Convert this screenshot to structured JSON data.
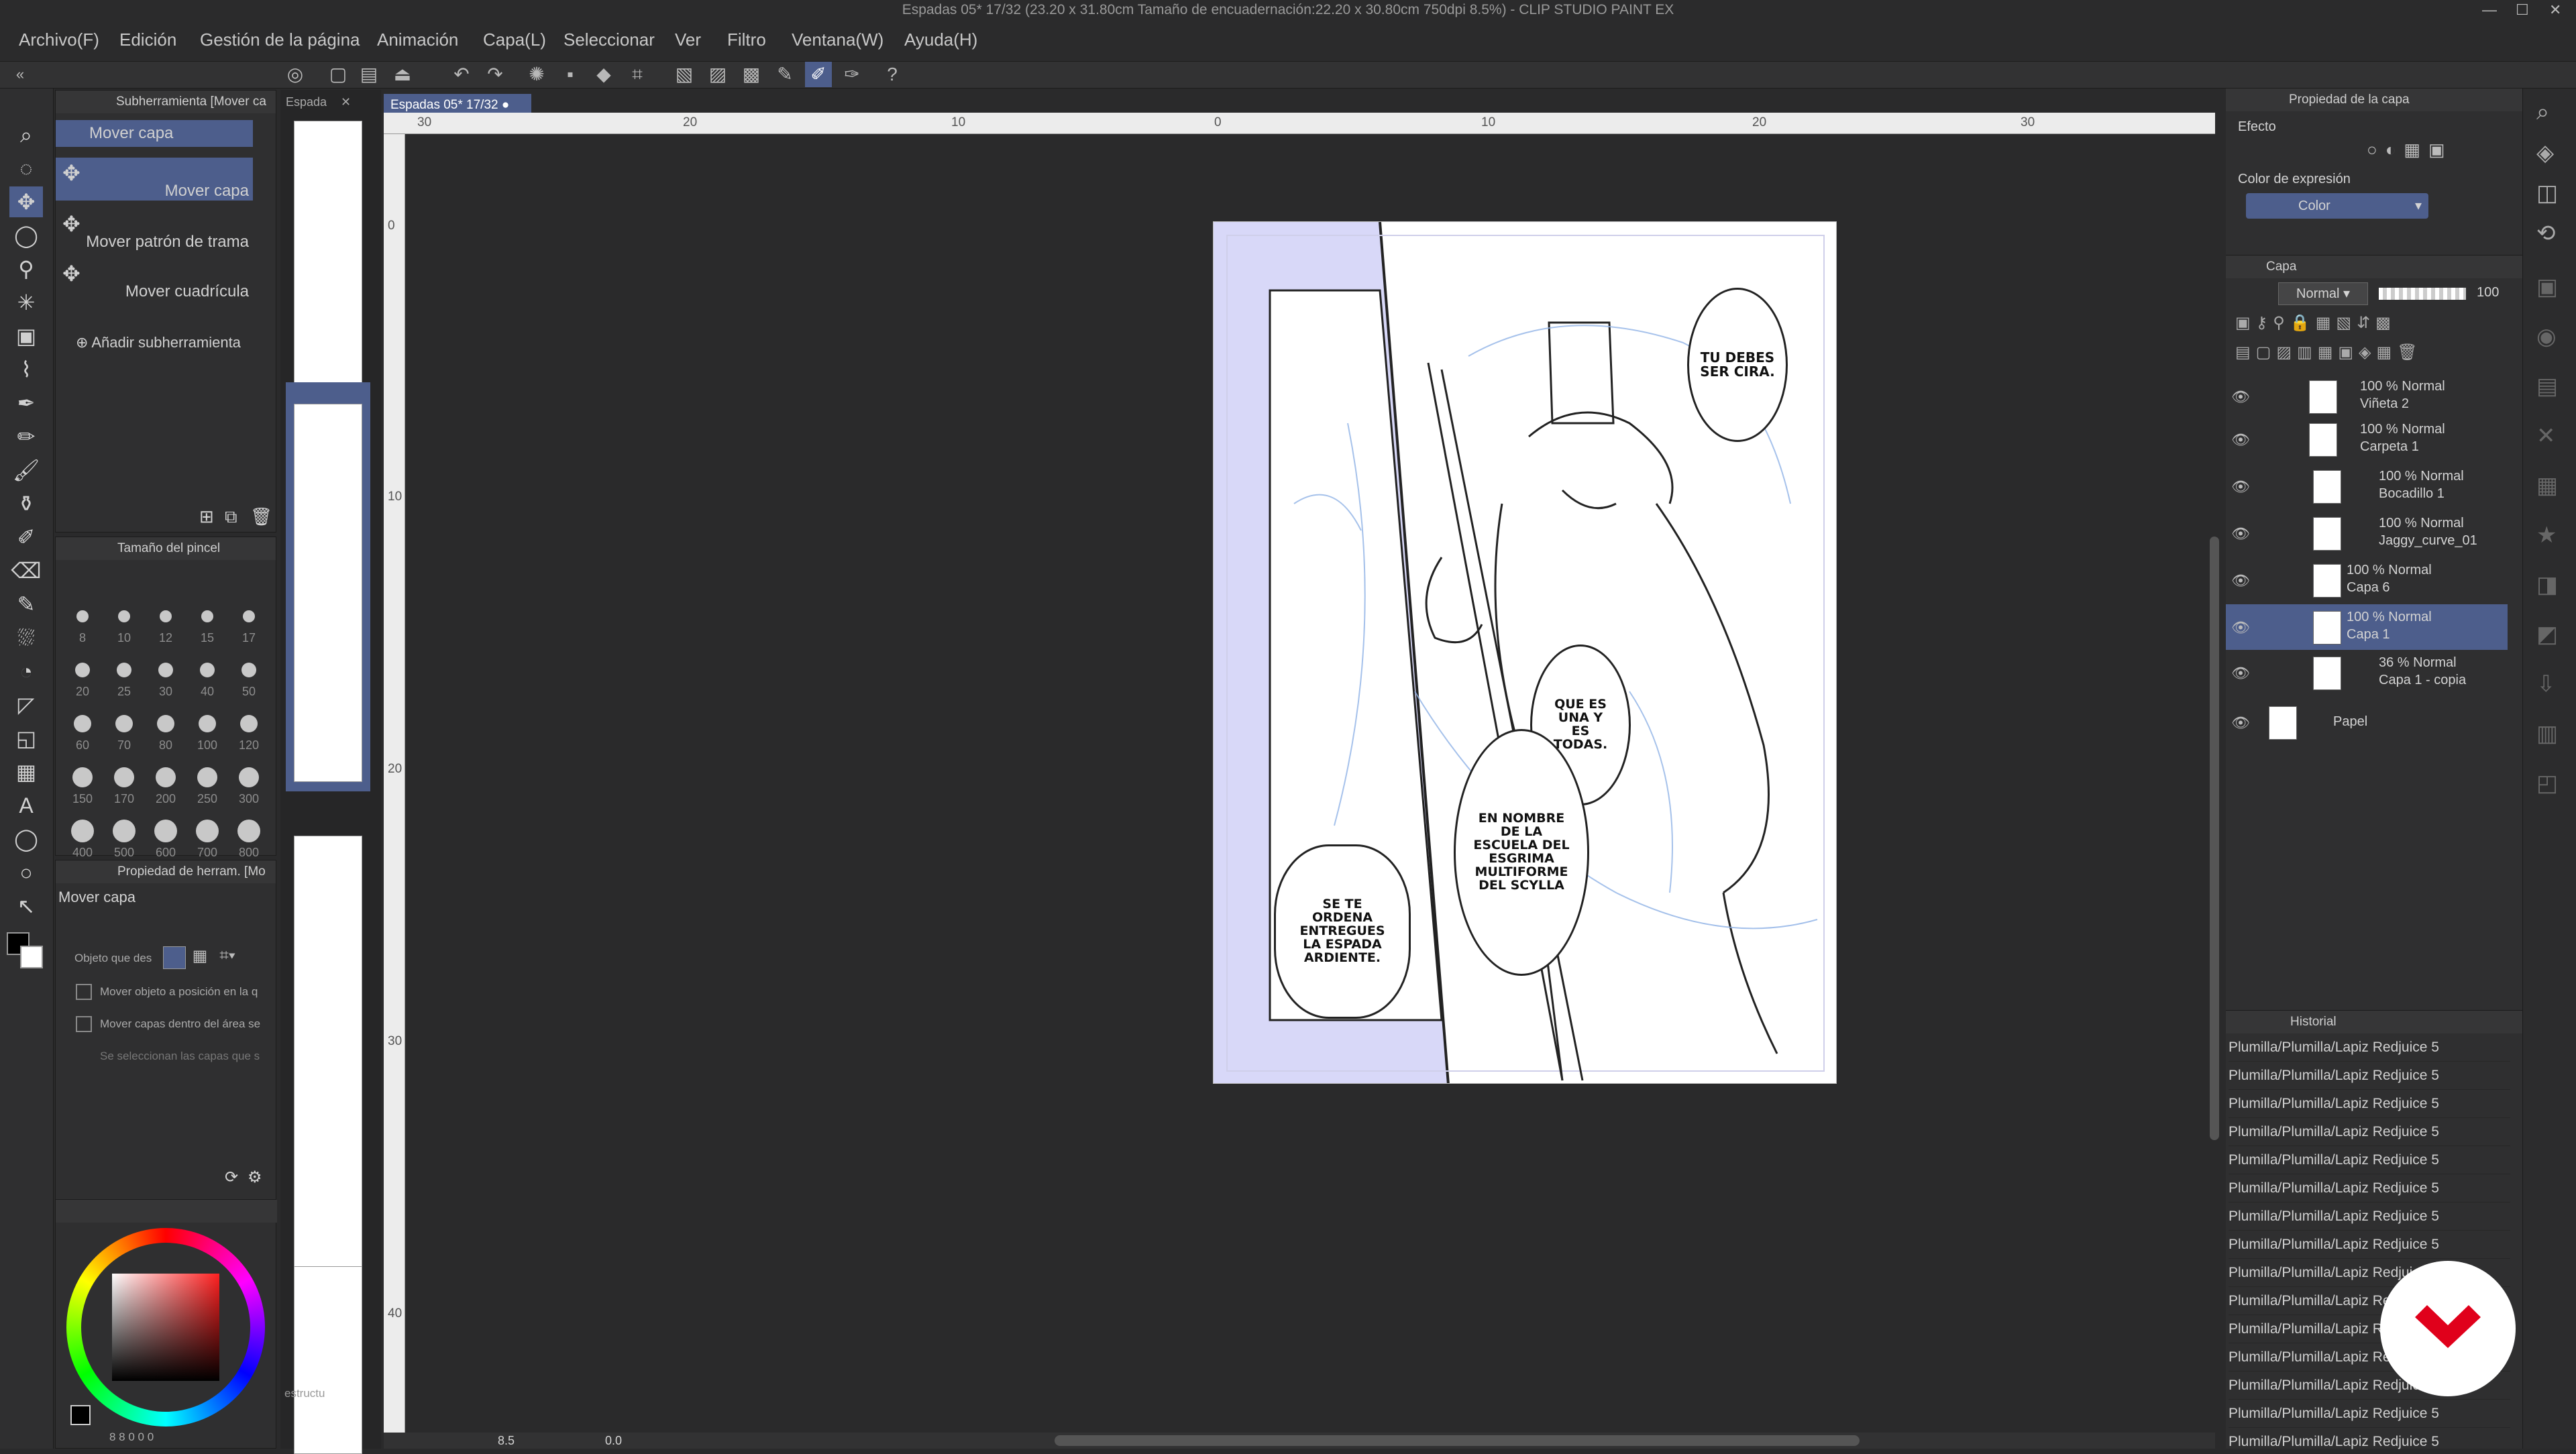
{
  "window": {
    "title": "Espadas 05* 17/32 (23.20 x 31.80cm Tamaño de encuadernación:22.20 x 30.80cm 750dpi 8.5%) - CLIP STUDIO PAINT EX"
  },
  "menu": [
    "Archivo(F)",
    "Edición",
    "Gestión de la página",
    "Animación",
    "Capa(L)",
    "Seleccionar",
    "Ver",
    "Filtro",
    "Ventana(W)",
    "Ayuda(H)"
  ],
  "subtool": {
    "header": "Subherramienta [Mover ca",
    "tab2": "Espada",
    "items": [
      "Mover capa",
      "Mover capa",
      "Mover patrón de trama",
      "Mover cuadrícula"
    ],
    "add": "Añadir subherramienta"
  },
  "brushsize": {
    "header": "Tamaño del pincel",
    "sizes": [
      "8",
      "10",
      "12",
      "15",
      "17",
      "20",
      "25",
      "30",
      "40",
      "50",
      "60",
      "70",
      "80",
      "100",
      "120",
      "150",
      "170",
      "200",
      "250",
      "300",
      "400",
      "500",
      "600",
      "700",
      "800"
    ]
  },
  "toolprop": {
    "header": "Propiedad de herram. [Mo",
    "tool": "Mover capa",
    "obj_label": "Objeto que des",
    "opt1": "Mover objeto a posición en la q",
    "opt2": "Mover capas dentro del área se",
    "opt3": "Se seleccionan las capas que s"
  },
  "navigator": {
    "label": "estructu"
  },
  "colorbar": {
    "values": "8 8 0 0 0"
  },
  "doc": {
    "tab": "Espadas 05* 17/32"
  },
  "ruler": {
    "top": [
      "30",
      "20",
      "10",
      "0",
      "10",
      "20",
      "30"
    ],
    "left": [
      "0",
      "10",
      "20",
      "30",
      "40"
    ]
  },
  "canvas": {
    "balloons": [
      "TU DEBES SER CIRA.",
      "QUE ES UNA Y ES TODAS.",
      "EN NOMBRE DE LA ESCUELA DEL ESGRIMA MULTIFORME DEL SCYLLA",
      "SE TE ORDENA ENTREGUES LA ESPADA ARDIENTE."
    ]
  },
  "status": {
    "zoom": "8.5",
    "angle": "0.0"
  },
  "layerprop": {
    "header": "Propiedad de la capa",
    "effect": "Efecto",
    "expr_label": "Color de expresión",
    "expr_value": "Color"
  },
  "layers": {
    "header": "Capa",
    "blend": "Normal",
    "opacity": "100",
    "items": [
      {
        "pct": "100 % Normal",
        "name": "Viñeta 2"
      },
      {
        "pct": "100 % Normal",
        "name": "Carpeta 1"
      },
      {
        "pct": "100 % Normal",
        "name": "Bocadillo 1"
      },
      {
        "pct": "100 % Normal",
        "name": "Jaggy_curve_01"
      },
      {
        "pct": "100 % Normal",
        "name": "Capa 6"
      },
      {
        "pct": "100 % Normal",
        "name": "Capa 1"
      },
      {
        "pct": "36 % Normal",
        "name": "Capa 1 - copia"
      },
      {
        "pct": "",
        "name": "Papel"
      }
    ]
  },
  "history": {
    "header": "Historial",
    "items": [
      "Plumilla/Plumilla/Lapiz Redjuice 5",
      "Plumilla/Plumilla/Lapiz Redjuice 5",
      "Plumilla/Plumilla/Lapiz Redjuice 5",
      "Plumilla/Plumilla/Lapiz Redjuice 5",
      "Plumilla/Plumilla/Lapiz Redjuice 5",
      "Plumilla/Plumilla/Lapiz Redjuice 5",
      "Plumilla/Plumilla/Lapiz Redjuice 5",
      "Plumilla/Plumilla/Lapiz Redjuice 5",
      "Plumilla/Plumilla/Lapiz Redjuice 5",
      "Plumilla/Plumilla/Lapiz Redjuice 5",
      "Plumilla/Plumilla/Lapiz Redjuice 5",
      "Plumilla/Plumilla/Lapiz Redjuice 5",
      "Plumilla/Plumilla/Lapiz Redjuice 5",
      "Plumilla/Plumilla/Lapiz Redjuice 5",
      "Plumilla/Plumilla/Lapiz Redjuice 5",
      "Plumilla/Plumilla/Lapiz Redjuice 5"
    ]
  },
  "colors": {
    "accent": "#4d5e8c",
    "panel": "#2f2f30",
    "canvas_bg": "#2a2a2b",
    "frame_fill": "#d8d8f8",
    "logo": "#e0001b"
  }
}
